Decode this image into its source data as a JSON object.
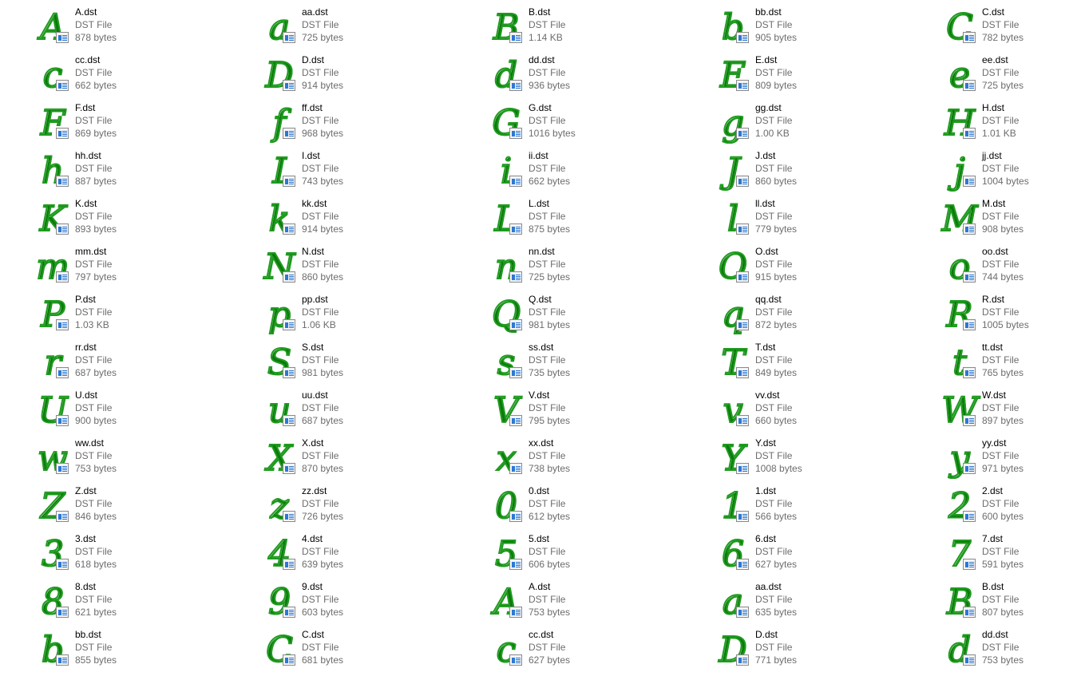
{
  "colors": {
    "stitch": "#1f9b1f",
    "secondary_text": "#6d6d6d",
    "badge_accent": "#2b78d6"
  },
  "icons": {
    "thumbnail": "embroidery-letter-thumbnail",
    "overlay": "document-type-icon"
  },
  "files": [
    {
      "glyph": "A",
      "name": "A.dst",
      "type": "DST File",
      "size": "878 bytes"
    },
    {
      "glyph": "a",
      "name": "aa.dst",
      "type": "DST File",
      "size": "725 bytes"
    },
    {
      "glyph": "B",
      "name": "B.dst",
      "type": "DST File",
      "size": "1.14 KB"
    },
    {
      "glyph": "b",
      "name": "bb.dst",
      "type": "DST File",
      "size": "905 bytes"
    },
    {
      "glyph": "C",
      "name": "C.dst",
      "type": "DST File",
      "size": "782 bytes"
    },
    {
      "glyph": "c",
      "name": "cc.dst",
      "type": "DST File",
      "size": "662 bytes"
    },
    {
      "glyph": "D",
      "name": "D.dst",
      "type": "DST File",
      "size": "914 bytes"
    },
    {
      "glyph": "d",
      "name": "dd.dst",
      "type": "DST File",
      "size": "936 bytes"
    },
    {
      "glyph": "E",
      "name": "E.dst",
      "type": "DST File",
      "size": "809 bytes"
    },
    {
      "glyph": "e",
      "name": "ee.dst",
      "type": "DST File",
      "size": "725 bytes"
    },
    {
      "glyph": "F",
      "name": "F.dst",
      "type": "DST File",
      "size": "869 bytes"
    },
    {
      "glyph": "f",
      "name": "ff.dst",
      "type": "DST File",
      "size": "968 bytes"
    },
    {
      "glyph": "G",
      "name": "G.dst",
      "type": "DST File",
      "size": "1016 bytes"
    },
    {
      "glyph": "g",
      "name": "gg.dst",
      "type": "DST File",
      "size": "1.00 KB"
    },
    {
      "glyph": "H",
      "name": "H.dst",
      "type": "DST File",
      "size": "1.01 KB"
    },
    {
      "glyph": "h",
      "name": "hh.dst",
      "type": "DST File",
      "size": "887 bytes"
    },
    {
      "glyph": "I",
      "name": "I.dst",
      "type": "DST File",
      "size": "743 bytes"
    },
    {
      "glyph": "i",
      "name": "ii.dst",
      "type": "DST File",
      "size": "662 bytes"
    },
    {
      "glyph": "J",
      "name": "J.dst",
      "type": "DST File",
      "size": "860 bytes"
    },
    {
      "glyph": "j",
      "name": "jj.dst",
      "type": "DST File",
      "size": "1004 bytes"
    },
    {
      "glyph": "K",
      "name": "K.dst",
      "type": "DST File",
      "size": "893 bytes"
    },
    {
      "glyph": "k",
      "name": "kk.dst",
      "type": "DST File",
      "size": "914 bytes"
    },
    {
      "glyph": "L",
      "name": "L.dst",
      "type": "DST File",
      "size": "875 bytes"
    },
    {
      "glyph": "l",
      "name": "ll.dst",
      "type": "DST File",
      "size": "779 bytes"
    },
    {
      "glyph": "M",
      "name": "M.dst",
      "type": "DST File",
      "size": "908 bytes"
    },
    {
      "glyph": "m",
      "name": "mm.dst",
      "type": "DST File",
      "size": "797 bytes"
    },
    {
      "glyph": "N",
      "name": "N.dst",
      "type": "DST File",
      "size": "860 bytes"
    },
    {
      "glyph": "n",
      "name": "nn.dst",
      "type": "DST File",
      "size": "725 bytes"
    },
    {
      "glyph": "O",
      "name": "O.dst",
      "type": "DST File",
      "size": "915 bytes"
    },
    {
      "glyph": "o",
      "name": "oo.dst",
      "type": "DST File",
      "size": "744 bytes"
    },
    {
      "glyph": "P",
      "name": "P.dst",
      "type": "DST File",
      "size": "1.03 KB"
    },
    {
      "glyph": "p",
      "name": "pp.dst",
      "type": "DST File",
      "size": "1.06 KB"
    },
    {
      "glyph": "Q",
      "name": "Q.dst",
      "type": "DST File",
      "size": "981 bytes"
    },
    {
      "glyph": "q",
      "name": "qq.dst",
      "type": "DST File",
      "size": "872 bytes"
    },
    {
      "glyph": "R",
      "name": "R.dst",
      "type": "DST File",
      "size": "1005 bytes"
    },
    {
      "glyph": "r",
      "name": "rr.dst",
      "type": "DST File",
      "size": "687 bytes"
    },
    {
      "glyph": "S",
      "name": "S.dst",
      "type": "DST File",
      "size": "981 bytes"
    },
    {
      "glyph": "s",
      "name": "ss.dst",
      "type": "DST File",
      "size": "735 bytes"
    },
    {
      "glyph": "T",
      "name": "T.dst",
      "type": "DST File",
      "size": "849 bytes"
    },
    {
      "glyph": "t",
      "name": "tt.dst",
      "type": "DST File",
      "size": "765 bytes"
    },
    {
      "glyph": "U",
      "name": "U.dst",
      "type": "DST File",
      "size": "900 bytes"
    },
    {
      "glyph": "u",
      "name": "uu.dst",
      "type": "DST File",
      "size": "687 bytes"
    },
    {
      "glyph": "V",
      "name": "V.dst",
      "type": "DST File",
      "size": "795 bytes"
    },
    {
      "glyph": "v",
      "name": "vv.dst",
      "type": "DST File",
      "size": "660 bytes"
    },
    {
      "glyph": "W",
      "name": "W.dst",
      "type": "DST File",
      "size": "897 bytes"
    },
    {
      "glyph": "w",
      "name": "ww.dst",
      "type": "DST File",
      "size": "753 bytes"
    },
    {
      "glyph": "X",
      "name": "X.dst",
      "type": "DST File",
      "size": "870 bytes"
    },
    {
      "glyph": "x",
      "name": "xx.dst",
      "type": "DST File",
      "size": "738 bytes"
    },
    {
      "glyph": "Y",
      "name": "Y.dst",
      "type": "DST File",
      "size": "1008 bytes"
    },
    {
      "glyph": "y",
      "name": "yy.dst",
      "type": "DST File",
      "size": "971 bytes"
    },
    {
      "glyph": "Z",
      "name": "Z.dst",
      "type": "DST File",
      "size": "846 bytes"
    },
    {
      "glyph": "z",
      "name": "zz.dst",
      "type": "DST File",
      "size": "726 bytes"
    },
    {
      "glyph": "0",
      "name": "0.dst",
      "type": "DST File",
      "size": "612 bytes"
    },
    {
      "glyph": "1",
      "name": "1.dst",
      "type": "DST File",
      "size": "566 bytes"
    },
    {
      "glyph": "2",
      "name": "2.dst",
      "type": "DST File",
      "size": "600 bytes"
    },
    {
      "glyph": "3",
      "name": "3.dst",
      "type": "DST File",
      "size": "618 bytes"
    },
    {
      "glyph": "4",
      "name": "4.dst",
      "type": "DST File",
      "size": "639 bytes"
    },
    {
      "glyph": "5",
      "name": "5.dst",
      "type": "DST File",
      "size": "606 bytes"
    },
    {
      "glyph": "6",
      "name": "6.dst",
      "type": "DST File",
      "size": "627 bytes"
    },
    {
      "glyph": "7",
      "name": "7.dst",
      "type": "DST File",
      "size": "591 bytes"
    },
    {
      "glyph": "8",
      "name": "8.dst",
      "type": "DST File",
      "size": "621 bytes"
    },
    {
      "glyph": "9",
      "name": "9.dst",
      "type": "DST File",
      "size": "603 bytes"
    },
    {
      "glyph": "A",
      "name": "A.dst",
      "type": "DST File",
      "size": "753 bytes"
    },
    {
      "glyph": "a",
      "name": "aa.dst",
      "type": "DST File",
      "size": "635 bytes"
    },
    {
      "glyph": "B",
      "name": "B.dst",
      "type": "DST File",
      "size": "807 bytes"
    },
    {
      "glyph": "b",
      "name": "bb.dst",
      "type": "DST File",
      "size": "855 bytes"
    },
    {
      "glyph": "C",
      "name": "C.dst",
      "type": "DST File",
      "size": "681 bytes"
    },
    {
      "glyph": "c",
      "name": "cc.dst",
      "type": "DST File",
      "size": "627 bytes"
    },
    {
      "glyph": "D",
      "name": "D.dst",
      "type": "DST File",
      "size": "771 bytes"
    },
    {
      "glyph": "d",
      "name": "dd.dst",
      "type": "DST File",
      "size": "753 bytes"
    }
  ]
}
